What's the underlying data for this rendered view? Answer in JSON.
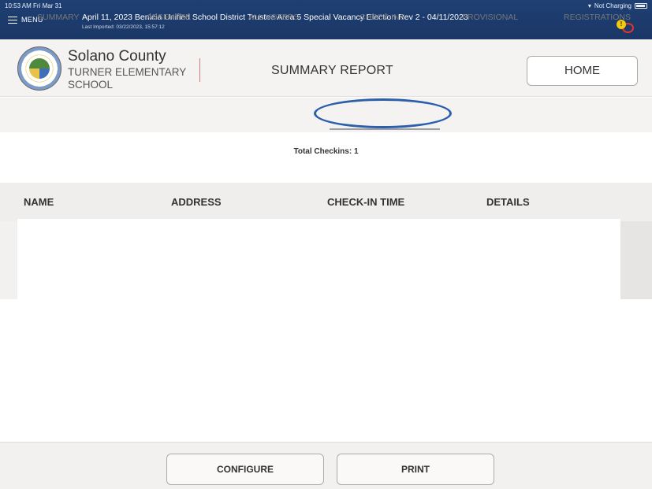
{
  "status_bar": {
    "time": "10:53 AM  Fri Mar 31",
    "battery_text": "Not Charging"
  },
  "menu": {
    "label": "MENU"
  },
  "header": {
    "title": "April 11, 2023 Benicia Unified School District Trustee Area 5 Special Vacancy Election Rev 2 - 04/11/2023",
    "last_imported": "Last Imported: 03/22/2023, 15:57:12",
    "notification_count": "!"
  },
  "org": {
    "county": "Solano County",
    "school": "TURNER ELEMENTARY SCHOOL"
  },
  "page": {
    "title": "SUMMARY REPORT",
    "home_label": "HOME"
  },
  "tabs": [
    {
      "label": "SUMMARY"
    },
    {
      "label": "ABSENTEE"
    },
    {
      "label": "ALL VOTERS"
    },
    {
      "label": "CHECK-INS",
      "active": true
    },
    {
      "label": "PROVISIONAL"
    },
    {
      "label": "REGISTRATIONS"
    }
  ],
  "summary": {
    "total_checkins": "Total Checkins: 1"
  },
  "table": {
    "columns": [
      "NAME",
      "ADDRESS",
      "CHECK-IN TIME",
      "DETAILS"
    ]
  },
  "footer": {
    "configure_label": "CONFIGURE",
    "print_label": "PRINT"
  },
  "colors": {
    "header_bg": "#1f3f73",
    "highlight": "#2c5faa",
    "panel_bg": "#f4f3f2"
  }
}
